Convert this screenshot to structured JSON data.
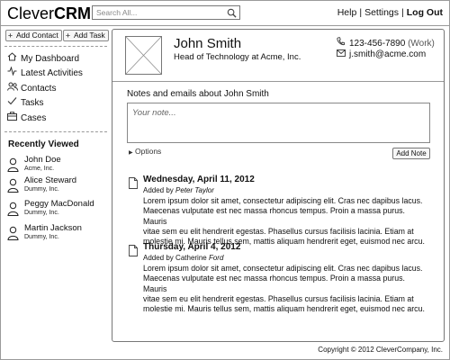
{
  "header": {
    "logo_regular": "Clever",
    "logo_bold": "CRM",
    "search_placeholder": "Search All...",
    "links": [
      "Help",
      "Settings",
      "Log Out"
    ],
    "link_separator": "|"
  },
  "sidebar": {
    "add_contact_label": "Add Contact",
    "add_task_label": "Add Task",
    "nav": [
      {
        "label": "My Dashboard",
        "icon": "home-icon"
      },
      {
        "label": "Latest Activities",
        "icon": "activity-icon"
      },
      {
        "label": "Contacts",
        "icon": "contacts-icon"
      },
      {
        "label": "Tasks",
        "icon": "checkmark-icon"
      },
      {
        "label": "Cases",
        "icon": "briefcase-icon"
      }
    ],
    "recently_viewed_title": "Recently Viewed",
    "recent": [
      {
        "name": "John Doe",
        "company": "Acme, Inc."
      },
      {
        "name": "Alice Steward",
        "company": "Dummy, Inc."
      },
      {
        "name": "Peggy MacDonald",
        "company": "Dummy, Inc."
      },
      {
        "name": "Martin Jackson",
        "company": "Dummy, Inc."
      }
    ]
  },
  "contact": {
    "name": "John Smith",
    "title": "Head of Technology at Acme, Inc.",
    "phone": "123-456-7890",
    "phone_type": "(Work)",
    "email": "j.smith@acme.com"
  },
  "notes": {
    "section_title": "Notes and emails about John Smith",
    "placeholder": "Your note...",
    "options_label": "Options",
    "add_note_label": "Add Note",
    "entries": [
      {
        "date": "Wednesday, April 11, 2012",
        "added_by_prefix": "Added by",
        "author_first": "Peter",
        "author_last": "Taylor",
        "lines": [
          "Lorem ipsum dolor sit amet, consectetur adipiscing elit. Cras nec dapibus lacus.",
          "Maecenas vulputate est nec massa rhoncus tempus. Proin a massa purus. Mauris",
          "vitae sem eu elit hendrerit egestas. Phasellus cursus facilisis lacinia. Etiam at",
          "molestie mi. Mauris tellus sem, mattis aliquam hendrerit eget, euismod nec arcu."
        ]
      },
      {
        "date": "Thursday, April 4, 2012",
        "added_by_prefix": "Added by",
        "author_first": "Catherine",
        "author_last": "Ford",
        "lines": [
          "Lorem ipsum dolor sit amet, consectetur adipiscing elit. Cras nec dapibus lacus.",
          "Maecenas vulputate est nec massa rhoncus tempus. Proin a massa purus. Mauris",
          "vitae sem eu elit hendrerit egestas. Phasellus cursus facilisis lacinia. Etiam at",
          "molestie mi. Mauris tellus sem, mattis aliquam hendrerit eget, euismod nec arcu."
        ]
      }
    ]
  },
  "footer": {
    "copyright": "Copyright © 2012 CleverCompany, Inc."
  }
}
